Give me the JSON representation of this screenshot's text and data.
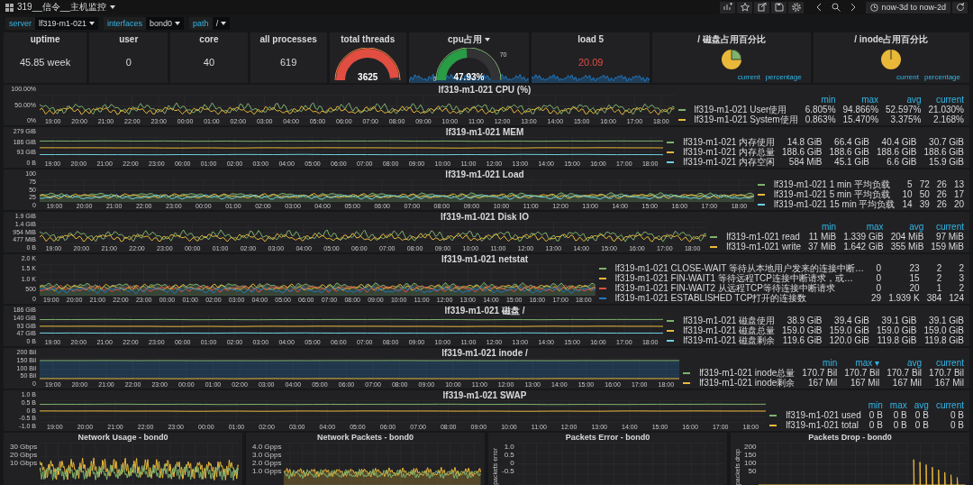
{
  "topbar": {
    "title": "319__信令__主机监控",
    "time_range": "now-3d to now-2d"
  },
  "variables": [
    {
      "label": "server",
      "value": "lf319-m1-021"
    },
    {
      "label": "interfaces",
      "value": "bond0"
    },
    {
      "label": "path",
      "value": "/"
    }
  ],
  "stats": [
    {
      "kind": "value",
      "title": "uptime",
      "value": "45.85 week",
      "alert": false
    },
    {
      "kind": "value",
      "title": "user",
      "value": "0",
      "alert": false
    },
    {
      "kind": "value",
      "title": "core",
      "value": "40",
      "alert": false
    },
    {
      "kind": "value",
      "title": "all processes",
      "value": "619",
      "alert": false
    },
    {
      "kind": "gauge",
      "title": "total threads",
      "value": "3625",
      "level": 0.97
    },
    {
      "kind": "gauge",
      "title": "cpu占用",
      "value": "47.93%",
      "level": 0.48,
      "scale_labels": [
        "0",
        "70"
      ],
      "sparkline": true
    },
    {
      "kind": "value",
      "title": "load 5",
      "value": "20.09",
      "alert": true,
      "sparkline": true
    },
    {
      "kind": "pie",
      "title": "/ 磁盘占用百分比",
      "legend_header": [
        "current",
        "percentage"
      ]
    },
    {
      "kind": "pie",
      "title": "/ inode占用百分比",
      "legend_header": [
        "current",
        "percentage"
      ]
    }
  ],
  "graphs": [
    {
      "title": "lf319-m1-021 CPU (%)",
      "kind": "noisy",
      "yticks": [
        "100.00%",
        "50.00%",
        "0%"
      ],
      "xticks": [
        "19:00",
        "20:00",
        "21:00",
        "22:00",
        "23:00",
        "00:00",
        "01:00",
        "02:00",
        "03:00",
        "04:00",
        "05:00",
        "06:00",
        "07:00",
        "08:00",
        "09:00",
        "10:00",
        "11:00",
        "12:00",
        "13:00",
        "14:00",
        "15:00",
        "16:00",
        "17:00",
        "18:00"
      ],
      "legend_header": [
        "min",
        "max",
        "avg",
        "current"
      ],
      "series": [
        {
          "name": "lf319-m1-021 User使用",
          "color": "#7eb26d",
          "legend_values": [
            "6.805%",
            "94.866%",
            "52.597%",
            "21.030%"
          ]
        },
        {
          "name": "lf319-m1-021 System使用",
          "color": "#eab839",
          "legend_values": [
            "0.863%",
            "15.470%",
            "3.375%",
            "2.168%"
          ]
        }
      ]
    },
    {
      "title": "lf319-m1-021 MEM",
      "kind": "flat",
      "yticks": [
        "279 GiB",
        "186 GiB",
        "93 GiB",
        "0 B"
      ],
      "xticks": [
        "19:00",
        "20:00",
        "21:00",
        "22:00",
        "23:00",
        "00:00",
        "01:00",
        "02:00",
        "03:00",
        "04:00",
        "05:00",
        "06:00",
        "07:00",
        "08:00",
        "09:00",
        "10:00",
        "11:00",
        "12:00",
        "13:00",
        "14:00",
        "15:00",
        "16:00",
        "17:00",
        "18:00"
      ],
      "series": [
        {
          "name": "lf319-m1-021 内存使用",
          "color": "#7eb26d",
          "legend_values": [
            "14.8 GiB",
            "66.4 GiB",
            "40.4 GiB",
            "30.7 GiB"
          ]
        },
        {
          "name": "lf319-m1-021 内存总量",
          "color": "#eab839",
          "legend_values": [
            "188.6 GiB",
            "188.6 GiB",
            "188.6 GiB",
            "188.6 GiB"
          ]
        },
        {
          "name": "lf319-m1-021 内存空闲",
          "color": "#6ed0e0",
          "legend_values": [
            "584 MiB",
            "45.1 GiB",
            "6.6 GiB",
            "15.9 GiB"
          ]
        }
      ]
    },
    {
      "title": "lf319-m1-021 Load",
      "kind": "area",
      "yticks": [
        "100",
        "75",
        "50",
        "25",
        "0"
      ],
      "xticks": [
        "19:00",
        "20:00",
        "21:00",
        "22:00",
        "23:00",
        "00:00",
        "01:00",
        "02:00",
        "03:00",
        "04:00",
        "05:00",
        "06:00",
        "07:00",
        "08:00",
        "09:00",
        "10:00",
        "11:00",
        "12:00",
        "13:00",
        "14:00",
        "15:00",
        "16:00",
        "17:00",
        "18:00"
      ],
      "series": [
        {
          "name": "lf319-m1-021 1 min 平均负载",
          "color": "#7eb26d",
          "legend_values": [
            "5",
            "72",
            "26",
            "13"
          ]
        },
        {
          "name": "lf319-m1-021 5 min 平均负载",
          "color": "#eab839",
          "legend_values": [
            "10",
            "50",
            "26",
            "17"
          ]
        },
        {
          "name": "lf319-m1-021 15 min 平均负载",
          "color": "#6ed0e0",
          "legend_values": [
            "14",
            "39",
            "26",
            "20"
          ]
        }
      ]
    },
    {
      "title": "lf319-m1-021 Disk IO",
      "kind": "noisy",
      "yticks": [
        "1.9 GiB",
        "1.4 GiB",
        "954 MiB",
        "477 MiB",
        "0 B"
      ],
      "xticks": [
        "19:00",
        "20:00",
        "21:00",
        "22:00",
        "23:00",
        "00:00",
        "01:00",
        "02:00",
        "03:00",
        "04:00",
        "05:00",
        "06:00",
        "07:00",
        "08:00",
        "09:00",
        "10:00",
        "11:00",
        "12:00",
        "13:00",
        "14:00",
        "15:00",
        "16:00",
        "17:00",
        "18:00"
      ],
      "legend_header": [
        "min",
        "max",
        "avg",
        "current"
      ],
      "series": [
        {
          "name": "lf319-m1-021 read",
          "color": "#7eb26d",
          "legend_values": [
            "11 MiB",
            "1.339 GiB",
            "204 MiB",
            "97 MiB"
          ]
        },
        {
          "name": "lf319-m1-021 write",
          "color": "#eab839",
          "legend_values": [
            "37 MiB",
            "1.642 GiB",
            "355 MiB",
            "159 MiB"
          ]
        }
      ]
    },
    {
      "title": "lf319-m1-021 netstat",
      "kind": "area",
      "yticks": [
        "2.0 K",
        "1.5 K",
        "1.0 K",
        "500",
        "0"
      ],
      "xticks": [
        "19:00",
        "20:00",
        "21:00",
        "22:00",
        "23:00",
        "00:00",
        "01:00",
        "02:00",
        "03:00",
        "04:00",
        "05:00",
        "06:00",
        "07:00",
        "08:00",
        "09:00",
        "10:00",
        "11:00",
        "12:00",
        "13:00",
        "14:00",
        "15:00",
        "16:00",
        "17:00",
        "18:00"
      ],
      "series": [
        {
          "name": "lf319-m1-021 CLOSE-WAIT 等待从本地用户发来的连接中断…",
          "color": "#7eb26d",
          "legend_values": [
            "0",
            "23",
            "2",
            "2"
          ]
        },
        {
          "name": "lf319-m1-021 FIN-WAIT1 等待远程TCP连接中断请求，或…",
          "color": "#eab839",
          "legend_values": [
            "0",
            "15",
            "2",
            "3"
          ]
        },
        {
          "name": "lf319-m1-021 FIN-WAIT2 从远程TCP等待连接中断请求",
          "color": "#e24d42",
          "legend_values": [
            "0",
            "20",
            "1",
            "2"
          ]
        },
        {
          "name": "lf319-m1-021 ESTABLISHED TCP打开的连接数",
          "color": "#1f78c1",
          "legend_values": [
            "29",
            "1.939 K",
            "384",
            "124"
          ]
        }
      ]
    },
    {
      "title": "lf319-m1-021 磁盘 /",
      "kind": "flat",
      "yticks": [
        "186 GiB",
        "140 GiB",
        "93 GiB",
        "47 GiB",
        "0 B"
      ],
      "xticks": [
        "19:00",
        "20:00",
        "21:00",
        "22:00",
        "23:00",
        "00:00",
        "01:00",
        "02:00",
        "03:00",
        "04:00",
        "05:00",
        "06:00",
        "07:00",
        "08:00",
        "09:00",
        "10:00",
        "11:00",
        "12:00",
        "13:00",
        "14:00",
        "15:00",
        "16:00",
        "17:00",
        "18:00"
      ],
      "series": [
        {
          "name": "lf319-m1-021 磁盘使用",
          "color": "#7eb26d",
          "legend_values": [
            "38.9 GiB",
            "39.4 GiB",
            "39.1 GiB",
            "39.1 GiB"
          ]
        },
        {
          "name": "lf319-m1-021 磁盘总量",
          "color": "#eab839",
          "legend_values": [
            "159.0 GiB",
            "159.0 GiB",
            "159.0 GiB",
            "159.0 GiB"
          ]
        },
        {
          "name": "lf319-m1-021 磁盘剩余",
          "color": "#6ed0e0",
          "legend_values": [
            "119.6 GiB",
            "120.0 GiB",
            "119.8 GiB",
            "119.8 GiB"
          ]
        }
      ]
    },
    {
      "title": "lf319-m1-021 inode /",
      "kind": "band",
      "yticks": [
        "200 Bil",
        "150 Bil",
        "100 Bil",
        "50 Bil",
        "0"
      ],
      "xticks": [
        "19:00",
        "20:00",
        "21:00",
        "22:00",
        "23:00",
        "00:00",
        "01:00",
        "02:00",
        "03:00",
        "04:00",
        "05:00",
        "06:00",
        "07:00",
        "08:00",
        "09:00",
        "10:00",
        "11:00",
        "12:00",
        "13:00",
        "14:00",
        "15:00",
        "16:00",
        "17:00",
        "18:00"
      ],
      "legend_header": [
        "min",
        "max ▾",
        "avg",
        "current"
      ],
      "series": [
        {
          "name": "lf319-m1-021 inode总量",
          "color": "#7eb26d",
          "legend_values": [
            "170.7 Bil",
            "170.7 Bil",
            "170.7 Bil",
            "170.7 Bil"
          ]
        },
        {
          "name": "lf319-m1-021 inode剩余",
          "color": "#eab839",
          "legend_values": [
            "167 Mil",
            "167 Mil",
            "167 Mil",
            "167 Mil"
          ]
        }
      ]
    },
    {
      "title": "lf319-m1-021 SWAP",
      "kind": "flat",
      "yticks": [
        "1.0 B",
        "0.5 B",
        "0 B",
        "-0.5 B",
        "-1.0 B"
      ],
      "xticks": [
        "19:00",
        "20:00",
        "21:00",
        "22:00",
        "23:00",
        "00:00",
        "01:00",
        "02:00",
        "03:00",
        "04:00",
        "05:00",
        "06:00",
        "07:00",
        "08:00",
        "09:00",
        "10:00",
        "11:00",
        "12:00",
        "13:00",
        "14:00",
        "15:00",
        "16:00",
        "17:00",
        "18:00"
      ],
      "legend_header": [
        "min",
        "max",
        "avg",
        "current"
      ],
      "series": [
        {
          "name": "lf319-m1-021 used",
          "color": "#7eb26d",
          "legend_values": [
            "0 B",
            "0 B",
            "0 B",
            "0 B"
          ]
        },
        {
          "name": "lf319-m1-021 total",
          "color": "#eab839",
          "legend_values": [
            "0 B",
            "0 B",
            "0 B",
            "0 B"
          ]
        }
      ]
    }
  ],
  "bottom_panels": [
    {
      "title": "Network Usage - bond0",
      "kind": "noisy",
      "yticks": [
        "30 Gbps",
        "20 Gbps",
        "10 Gbps"
      ]
    },
    {
      "title": "Network Packets - bond0",
      "kind": "area",
      "yticks": [
        "4.0 Gpps",
        "3.0 Gpps",
        "2.0 Gpps",
        "1.0 Gpps"
      ]
    },
    {
      "title": "Packets Error - bond0",
      "kind": "empty",
      "ylabel": "packets error",
      "yticks": [
        "1.0",
        "0.5",
        "0",
        "-0.5"
      ]
    },
    {
      "title": "Packets Drop - bond0",
      "kind": "spikes",
      "ylabel": "packets drop",
      "yticks": [
        "200",
        "150",
        "100",
        "50"
      ]
    }
  ]
}
